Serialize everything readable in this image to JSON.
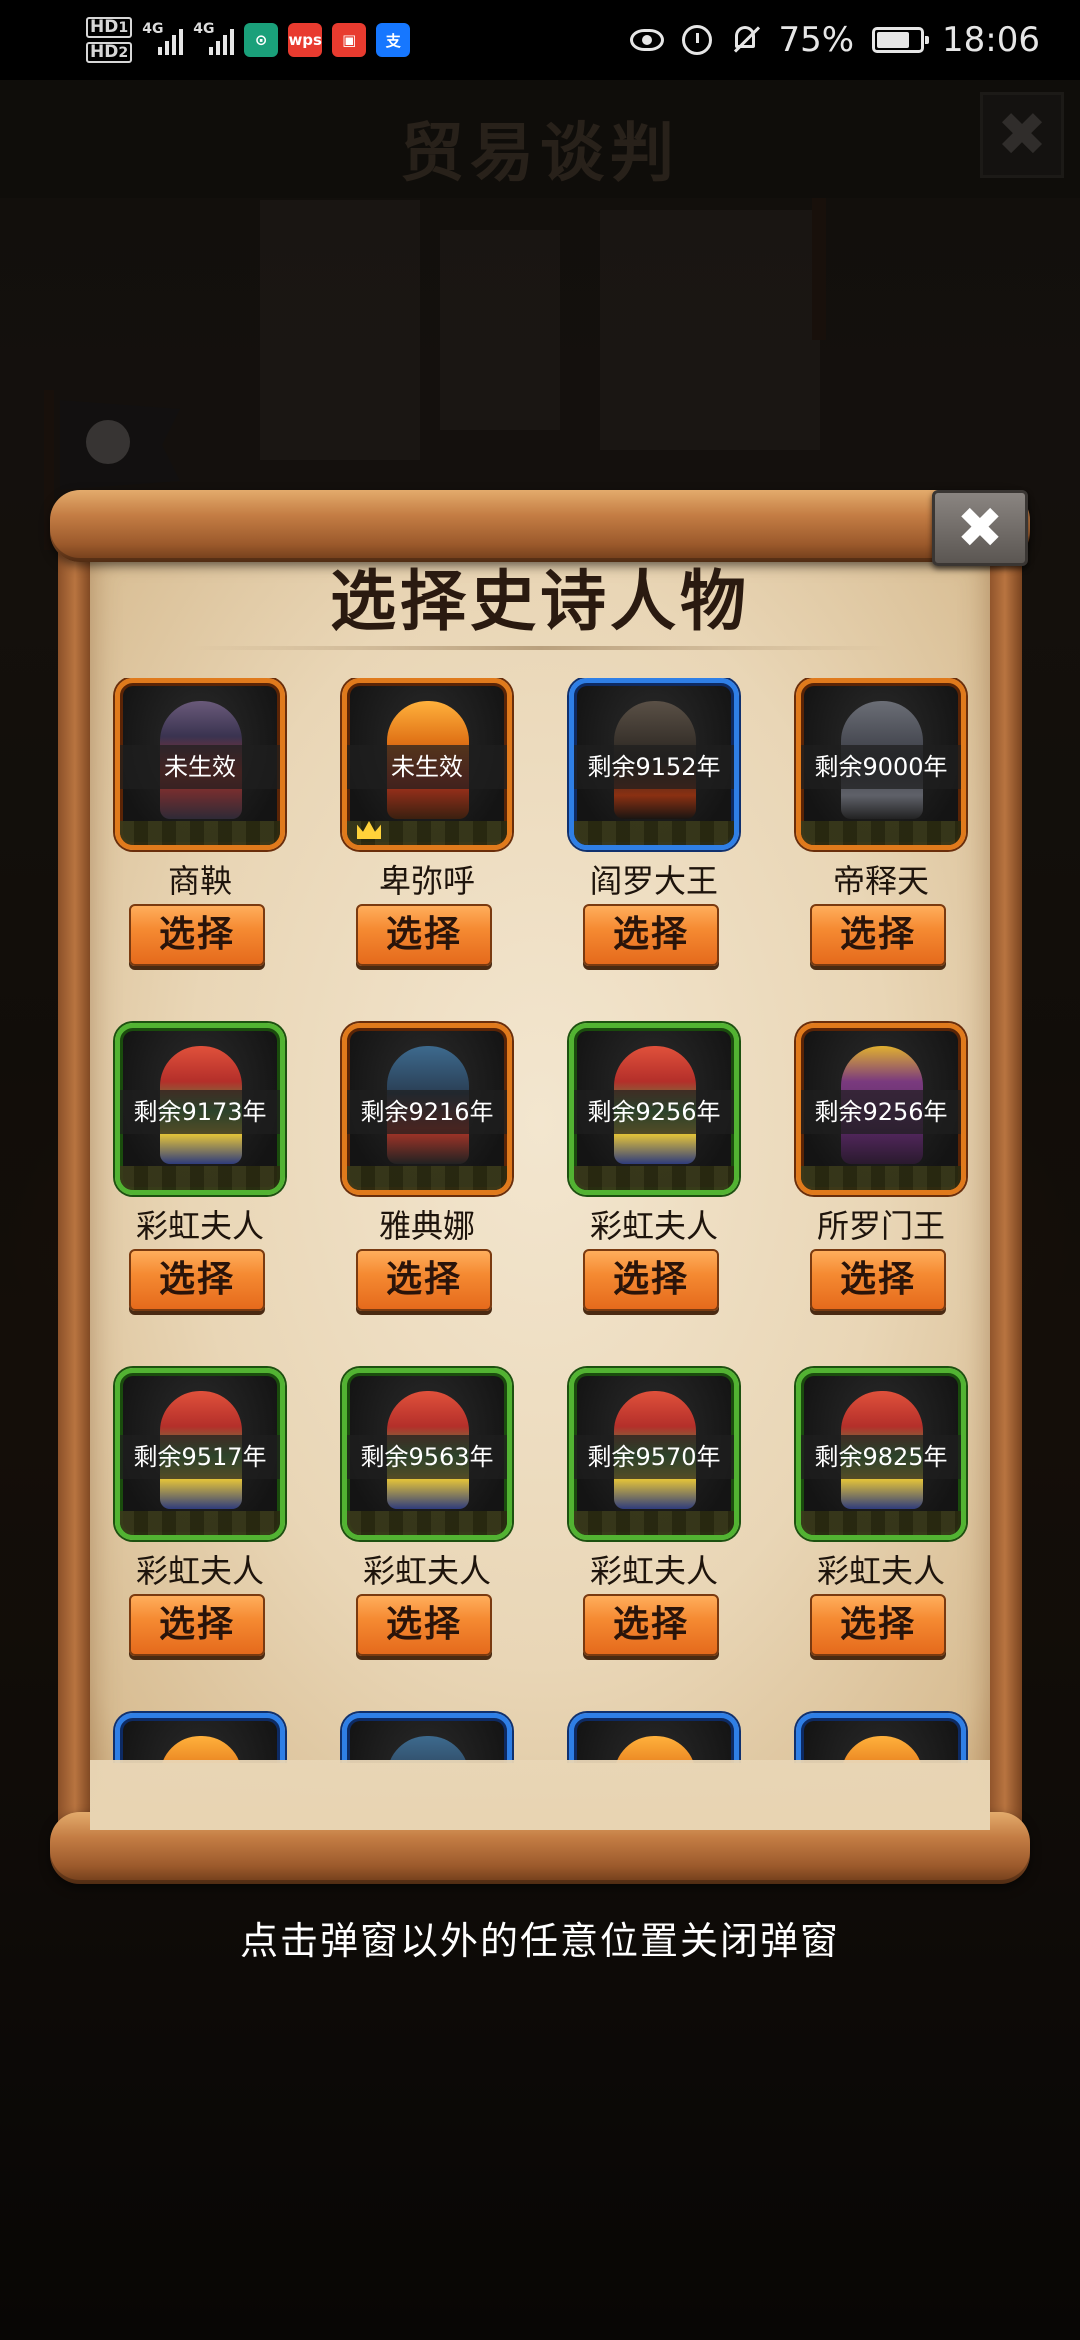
{
  "status_bar": {
    "hd1": "HD",
    "hd1_sub": "1",
    "hd2": "HD",
    "hd2_sub": "2",
    "net1": "4G",
    "net2": "4G",
    "apps": [
      {
        "name": "mi-icon",
        "label": "",
        "color": "#1aa07a"
      },
      {
        "name": "wps-icon",
        "label": "wps",
        "color": "#e83b2f"
      },
      {
        "name": "news-icon",
        "label": "",
        "color": "#e83b2f"
      },
      {
        "name": "alipay-icon",
        "label": "支",
        "color": "#1677ff"
      }
    ],
    "battery": "75%",
    "battery_level": 0.75,
    "time": "18:06"
  },
  "game_header": {
    "title": "贸易谈判",
    "close_label": "✖"
  },
  "dialog": {
    "title": "选择史诗人物",
    "close_label": "✖",
    "select_label": "选择",
    "characters": [
      {
        "name": "商鞅",
        "status": "未生效",
        "frame": "orange",
        "figure": "warrior"
      },
      {
        "name": "卑弥呼",
        "status": "未生效",
        "frame": "orange",
        "figure": "gold",
        "crown": true
      },
      {
        "name": "阎罗大王",
        "status": "剩余9152年",
        "frame": "blue",
        "figure": "dark"
      },
      {
        "name": "帝释天",
        "status": "剩余9000年",
        "frame": "orange",
        "figure": "grey"
      },
      {
        "name": "彩虹夫人",
        "status": "剩余9173年",
        "frame": "green",
        "figure": "red"
      },
      {
        "name": "雅典娜",
        "status": "剩余9216年",
        "frame": "orange",
        "figure": "blue"
      },
      {
        "name": "彩虹夫人",
        "status": "剩余9256年",
        "frame": "green",
        "figure": "red"
      },
      {
        "name": "所罗门王",
        "status": "剩余9256年",
        "frame": "orange",
        "figure": "king"
      },
      {
        "name": "彩虹夫人",
        "status": "剩余9517年",
        "frame": "green",
        "figure": "red"
      },
      {
        "name": "彩虹夫人",
        "status": "剩余9563年",
        "frame": "green",
        "figure": "red"
      },
      {
        "name": "彩虹夫人",
        "status": "剩余9570年",
        "frame": "green",
        "figure": "red"
      },
      {
        "name": "彩虹夫人",
        "status": "剩余9825年",
        "frame": "green",
        "figure": "red"
      },
      {
        "name": "",
        "status": "",
        "frame": "blue",
        "figure": "gold"
      },
      {
        "name": "",
        "status": "",
        "frame": "blue",
        "figure": "blue"
      },
      {
        "name": "",
        "status": "",
        "frame": "blue",
        "figure": "gold"
      },
      {
        "name": "",
        "status": "",
        "frame": "blue",
        "figure": "gold"
      }
    ]
  },
  "hint": "点击弹窗以外的任意位置关闭弹窗"
}
